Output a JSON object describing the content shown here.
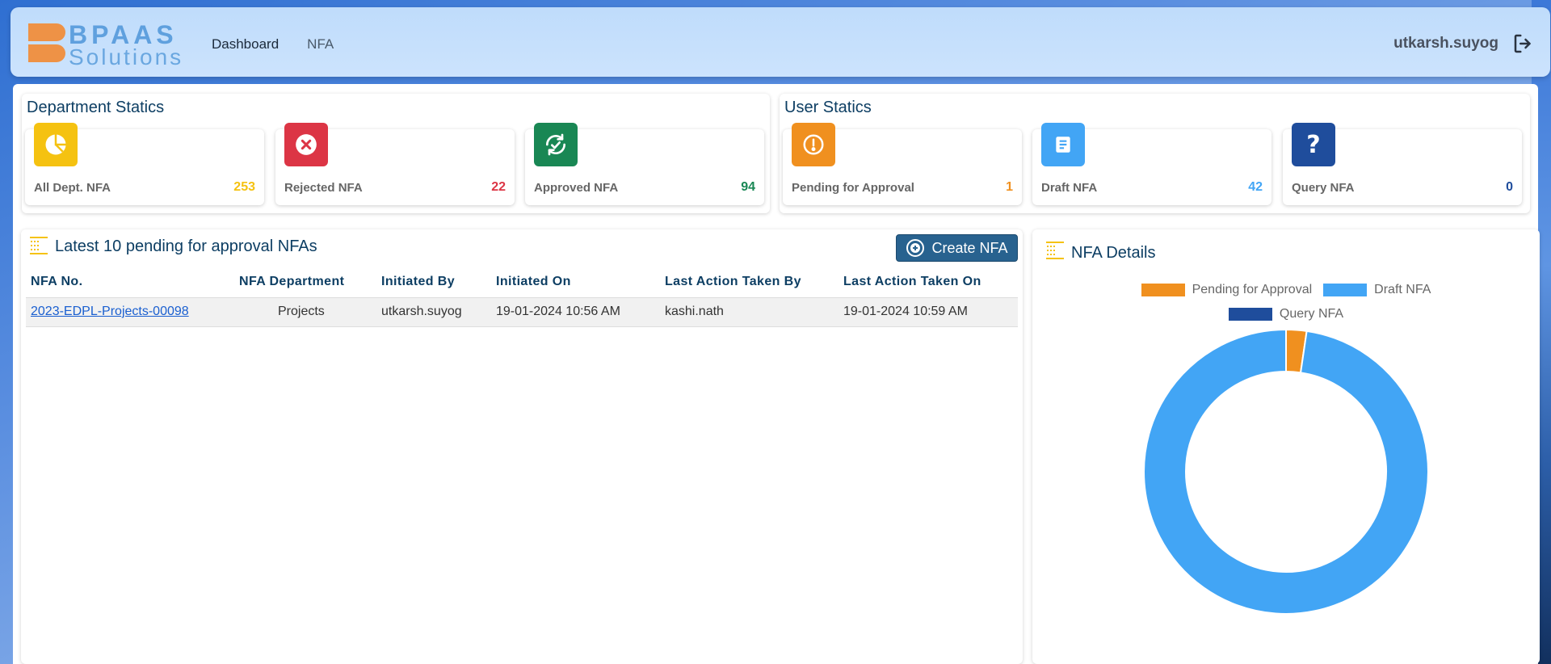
{
  "header": {
    "logo_line1": "BPAAS",
    "logo_line2": "Solutions",
    "nav": [
      {
        "label": "Dashboard"
      },
      {
        "label": "NFA"
      }
    ],
    "username": "utkarsh.suyog"
  },
  "department_stats": {
    "title": "Department Statics",
    "cards": [
      {
        "label": "All Dept. NFA",
        "value": "253",
        "color": "#f5c211",
        "icon": "pie-chart-icon"
      },
      {
        "label": "Rejected NFA",
        "value": "22",
        "color": "#dc3545",
        "icon": "close-circle-icon"
      },
      {
        "label": "Approved NFA",
        "value": "94",
        "color": "#198754",
        "icon": "sync-check-icon"
      }
    ]
  },
  "user_stats": {
    "title": "User Statics",
    "cards": [
      {
        "label": "Pending for Approval",
        "value": "1",
        "color": "#f0901f",
        "icon": "exclamation-circle-icon"
      },
      {
        "label": "Draft NFA",
        "value": "42",
        "color": "#42a5f5",
        "icon": "document-icon"
      },
      {
        "label": "Query NFA",
        "value": "0",
        "color": "#1f4d9c",
        "icon": "question-icon"
      }
    ]
  },
  "pending_table": {
    "title": "Latest 10 pending for approval NFAs",
    "create_button": "Create NFA",
    "columns": [
      "NFA No.",
      "NFA Department",
      "Initiated By",
      "Initiated On",
      "Last Action Taken By",
      "Last Action Taken On"
    ],
    "rows": [
      [
        "2023-EDPL-Projects-00098",
        "Projects",
        "utkarsh.suyog",
        "19-01-2024 10:56 AM",
        "kashi.nath",
        "19-01-2024 10:59 AM"
      ]
    ]
  },
  "chart_data": {
    "type": "pie",
    "title": "NFA Details",
    "labels": [
      "Pending for Approval",
      "Draft NFA",
      "Query NFA"
    ],
    "values": [
      1,
      42,
      0
    ],
    "colors": [
      "#f0901f",
      "#42a5f5",
      "#1f4d9c"
    ],
    "legend": "top"
  }
}
